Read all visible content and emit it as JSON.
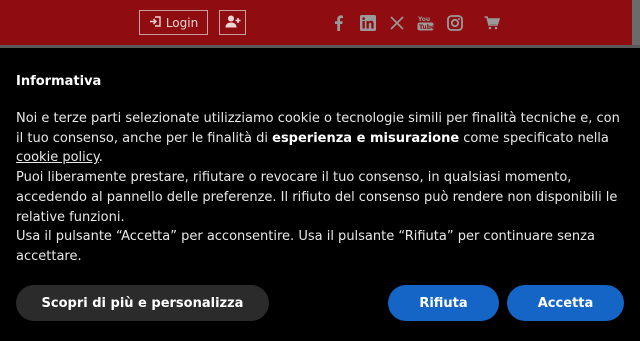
{
  "header": {
    "login_label": "Login",
    "icons": [
      "login-icon",
      "add-user-icon",
      "facebook-icon",
      "linkedin-icon",
      "x-icon",
      "youtube-icon",
      "instagram-icon",
      "cart-icon"
    ],
    "bar_color": "#8f0c10"
  },
  "banner": {
    "title": "Informativa",
    "para1_pre": "Noi e terze parti selezionate utilizziamo cookie o tecnologie simili per finalità tecniche e, con il tuo consenso, anche per le finalità di ",
    "para1_strong": "esperienza e misurazione",
    "para1_mid": " come specificato nella ",
    "para1_link": "cookie policy",
    "para1_end": ".",
    "para2": "Puoi liberamente prestare, rifiutare o revocare il tuo consenso, in qualsiasi momento, accedendo al pannello delle preferenze. Il rifiuto del consenso può rendere non disponibili le relative funzioni.",
    "para3": "Usa il pulsante “Accetta” per acconsentire. Usa il pulsante “Rifiuta” per continuare senza accettare."
  },
  "buttons": {
    "learn_more": "Scopri di più e personalizza",
    "reject": "Rifiuta",
    "accept": "Accetta",
    "primary_color": "#1565c7"
  }
}
